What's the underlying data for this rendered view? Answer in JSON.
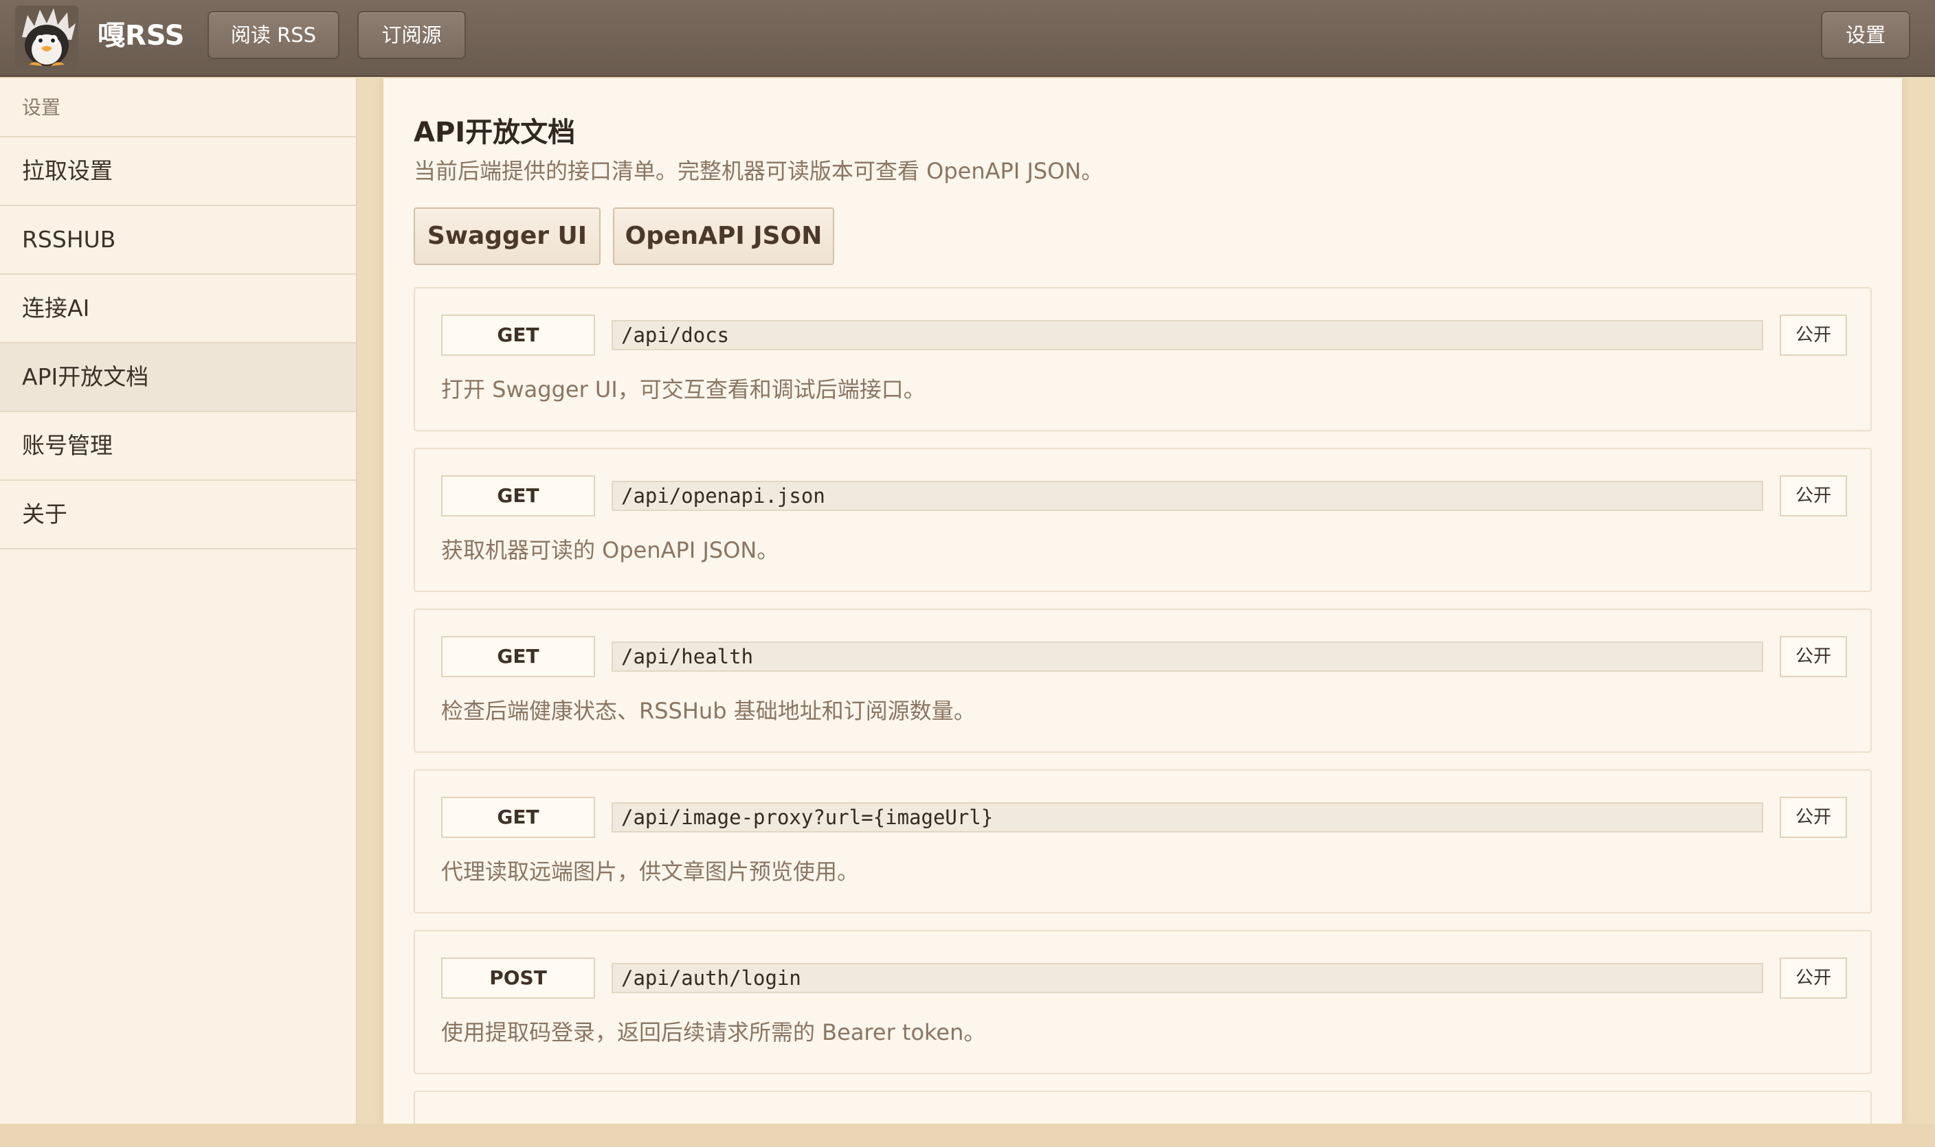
{
  "header": {
    "app_title": "嘎RSS",
    "nav": {
      "read": "阅读 RSS",
      "subscriptions": "订阅源"
    },
    "settings": "设置",
    "colors": {
      "bar": "#6a5b4f",
      "text": "#ffffff"
    }
  },
  "sidebar": {
    "header": "设置",
    "items": [
      {
        "label": "拉取设置"
      },
      {
        "label": "RSSHUB"
      },
      {
        "label": "连接AI"
      },
      {
        "label": "API开放文档",
        "active": true
      },
      {
        "label": "账号管理"
      },
      {
        "label": "关于"
      }
    ]
  },
  "main": {
    "title": "API开放文档",
    "subtitle": "当前后端提供的接口清单。完整机器可读版本可查看 OpenAPI JSON。",
    "buttons": {
      "swagger": "Swagger UI",
      "openapi": "OpenAPI JSON"
    },
    "endpoints": [
      {
        "method": "GET",
        "path": "/api/docs",
        "access": "公开",
        "description": "打开 Swagger UI，可交互查看和调试后端接口。"
      },
      {
        "method": "GET",
        "path": "/api/openapi.json",
        "access": "公开",
        "description": "获取机器可读的 OpenAPI JSON。"
      },
      {
        "method": "GET",
        "path": "/api/health",
        "access": "公开",
        "description": "检查后端健康状态、RSSHub 基础地址和订阅源数量。"
      },
      {
        "method": "GET",
        "path": "/api/image-proxy?url={imageUrl}",
        "access": "公开",
        "description": "代理读取远端图片，供文章图片预览使用。"
      },
      {
        "method": "POST",
        "path": "/api/auth/login",
        "access": "公开",
        "description": "使用提取码登录，返回后续请求所需的 Bearer token。"
      }
    ]
  }
}
